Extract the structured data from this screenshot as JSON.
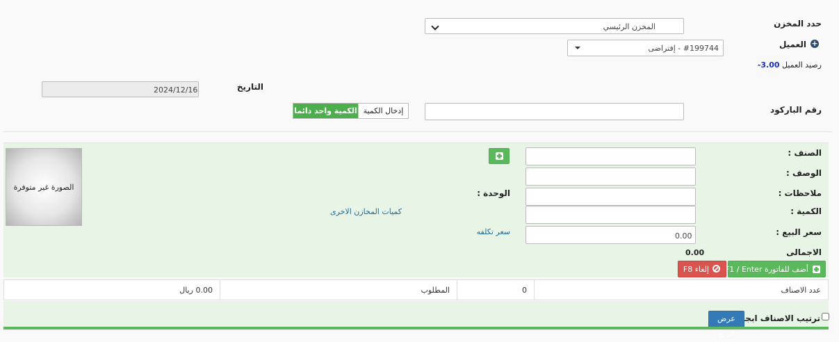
{
  "header": {
    "warehouse_label": "حدد المخزن",
    "warehouse_value": "المخزن الرئيسي",
    "customer_label": "العميل",
    "customer_value": "#199744 - إفتراضى",
    "balance_label": "رصيد العميل",
    "balance_value": "-3.00",
    "date_label": "التاريخ",
    "date_value": "2024/12/16",
    "barcode_label": "رقم الباركود",
    "barcode_value": "",
    "qty_mode_input": "إدخال الكمية",
    "qty_mode_fixed": "الكمية واحد دائما"
  },
  "item_form": {
    "item_label": "الصنف :",
    "desc_label": "الوصف :",
    "notes_label": "ملاحظات :",
    "qty_label": "الكمية :",
    "price_label": "سعر البيع :",
    "total_label": "الاجمالى",
    "total_value": "0.00",
    "unit_label": "الوحدة :",
    "price_value": "0.00",
    "other_stores_link": "كميات المخازن الاخرى",
    "cost_price_link": "سعر تكلفه",
    "image_placeholder": "الصورة غير متوفرة",
    "add_to_invoice": "أضف للفاتورة F1 / Enter",
    "cancel": "إلغاء F8"
  },
  "summary": {
    "items_count_label": "عدد الاصناف",
    "items_count_value": "0",
    "required_label": "المطلوب",
    "required_value": "0.00 ريال"
  },
  "footer": {
    "sort_label": "ترتيب الاصناف ابجدى",
    "show_profit": "عرض الربح"
  },
  "colors": {
    "accent_green": "#5cb85c",
    "danger_red": "#d9534f",
    "blue_button": "#337ab7",
    "panel_green": "#e7f4e6",
    "balance_blue": "#1a2ec8"
  }
}
